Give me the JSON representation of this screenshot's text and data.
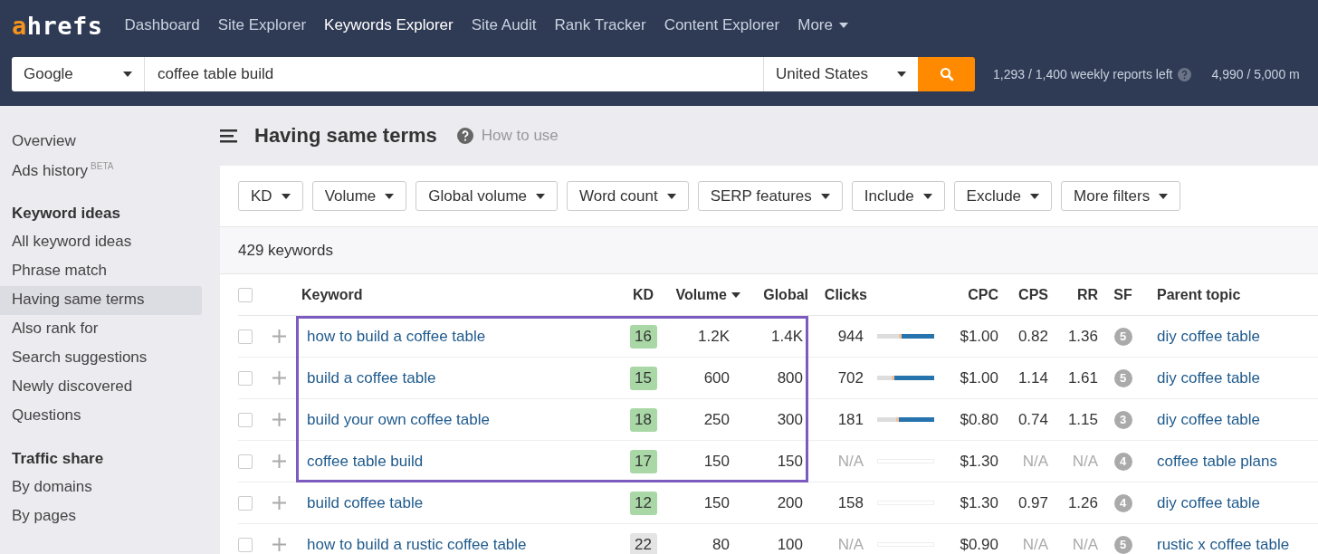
{
  "header": {
    "logo": "ahrefs",
    "nav": [
      {
        "label": "Dashboard",
        "selected": false
      },
      {
        "label": "Site Explorer",
        "selected": false
      },
      {
        "label": "Keywords Explorer",
        "selected": true
      },
      {
        "label": "Site Audit",
        "selected": false
      },
      {
        "label": "Rank Tracker",
        "selected": false
      },
      {
        "label": "Content Explorer",
        "selected": false
      },
      {
        "label": "More",
        "selected": false,
        "dropdown": true
      }
    ],
    "search": {
      "engine": "Google",
      "query": "coffee table build",
      "country": "United States"
    },
    "quota": [
      "1,293 / 1,400 weekly reports left",
      "4,990 / 5,000 m"
    ]
  },
  "sidebar": {
    "sections": [
      {
        "items": [
          {
            "label": "Overview",
            "selected": false
          },
          {
            "label": "Ads history",
            "badge": "BETA",
            "selected": false
          }
        ]
      },
      {
        "heading": "Keyword ideas",
        "items": [
          {
            "label": "All keyword ideas",
            "selected": false
          },
          {
            "label": "Phrase match",
            "selected": false
          },
          {
            "label": "Having same terms",
            "selected": true
          },
          {
            "label": "Also rank for",
            "selected": false
          },
          {
            "label": "Search suggestions",
            "selected": false
          },
          {
            "label": "Newly discovered",
            "selected": false
          },
          {
            "label": "Questions",
            "selected": false
          }
        ]
      },
      {
        "heading": "Traffic share",
        "items": [
          {
            "label": "By domains",
            "selected": false
          },
          {
            "label": "By pages",
            "selected": false
          }
        ]
      }
    ]
  },
  "page": {
    "title": "Having same terms",
    "help": "How to use"
  },
  "filters": [
    "KD",
    "Volume",
    "Global volume",
    "Word count",
    "SERP features",
    "Include",
    "Exclude",
    "More filters"
  ],
  "count": "429 keywords",
  "table": {
    "all_checked": false,
    "columns": [
      {
        "label": "Keyword",
        "sorted": false
      },
      {
        "label": "KD",
        "sorted": false
      },
      {
        "label": "Volume",
        "sorted": true
      },
      {
        "label": "Global",
        "sorted": false
      },
      {
        "label": "Clicks",
        "sorted": false
      },
      {
        "label": "CPC",
        "sorted": false
      },
      {
        "label": "CPS",
        "sorted": false
      },
      {
        "label": "RR",
        "sorted": false
      },
      {
        "label": "SF",
        "sorted": false
      },
      {
        "label": "Parent topic",
        "sorted": false
      }
    ],
    "rows": [
      {
        "checked": false,
        "keyword": "how to build a coffee table",
        "kd": {
          "text": "16",
          "color": "#a9d8a6"
        },
        "volume": "1.2K",
        "global": "1.4K",
        "clicks": {
          "text": "944",
          "muted": false
        },
        "bar": {
          "available": true,
          "level": 0.57
        },
        "cpc": "$1.00",
        "cps": {
          "text": "0.82",
          "muted": false
        },
        "rr": {
          "text": "1.36",
          "muted": false
        },
        "sf": "5",
        "parent": "diy coffee table",
        "highlighted": true
      },
      {
        "checked": false,
        "keyword": "build a coffee table",
        "kd": {
          "text": "15",
          "color": "#a9d8a6"
        },
        "volume": "600",
        "global": "800",
        "clicks": {
          "text": "702",
          "muted": false
        },
        "bar": {
          "available": true,
          "level": 0.7
        },
        "cpc": "$1.00",
        "cps": {
          "text": "1.14",
          "muted": false
        },
        "rr": {
          "text": "1.61",
          "muted": false
        },
        "sf": "5",
        "parent": "diy coffee table",
        "highlighted": true
      },
      {
        "checked": false,
        "keyword": "build your own coffee table",
        "kd": {
          "text": "18",
          "color": "#a9d8a6"
        },
        "volume": "250",
        "global": "300",
        "clicks": {
          "text": "181",
          "muted": false
        },
        "bar": {
          "available": true,
          "level": 0.62
        },
        "cpc": "$0.80",
        "cps": {
          "text": "0.74",
          "muted": false
        },
        "rr": {
          "text": "1.15",
          "muted": false
        },
        "sf": "3",
        "parent": "diy coffee table",
        "highlighted": true
      },
      {
        "checked": false,
        "keyword": "coffee table build",
        "kd": {
          "text": "17",
          "color": "#a9d8a6"
        },
        "volume": "150",
        "global": "150",
        "clicks": {
          "text": "N/A",
          "muted": true
        },
        "bar": {
          "available": false
        },
        "cpc": "$1.30",
        "cps": {
          "text": "N/A",
          "muted": true
        },
        "rr": {
          "text": "N/A",
          "muted": true
        },
        "sf": "4",
        "parent": "coffee table plans",
        "highlighted": true
      },
      {
        "checked": false,
        "keyword": "build coffee table",
        "kd": {
          "text": "12",
          "color": "#a9d8a6"
        },
        "volume": "150",
        "global": "200",
        "clicks": {
          "text": "158",
          "muted": false
        },
        "bar": {
          "available": false
        },
        "cpc": "$1.30",
        "cps": {
          "text": "0.97",
          "muted": false
        },
        "rr": {
          "text": "1.26",
          "muted": false
        },
        "sf": "4",
        "parent": "diy coffee table",
        "highlighted": false
      },
      {
        "checked": false,
        "keyword": "how to build a rustic coffee table",
        "kd": {
          "text": "22",
          "color": "#e4e4e4"
        },
        "volume": "80",
        "global": "100",
        "clicks": {
          "text": "N/A",
          "muted": true
        },
        "bar": {
          "available": false
        },
        "cpc": "$0.90",
        "cps": {
          "text": "N/A",
          "muted": true
        },
        "rr": {
          "text": "N/A",
          "muted": true
        },
        "sf": "5",
        "parent": "rustic x coffee table",
        "highlighted": false
      }
    ]
  }
}
